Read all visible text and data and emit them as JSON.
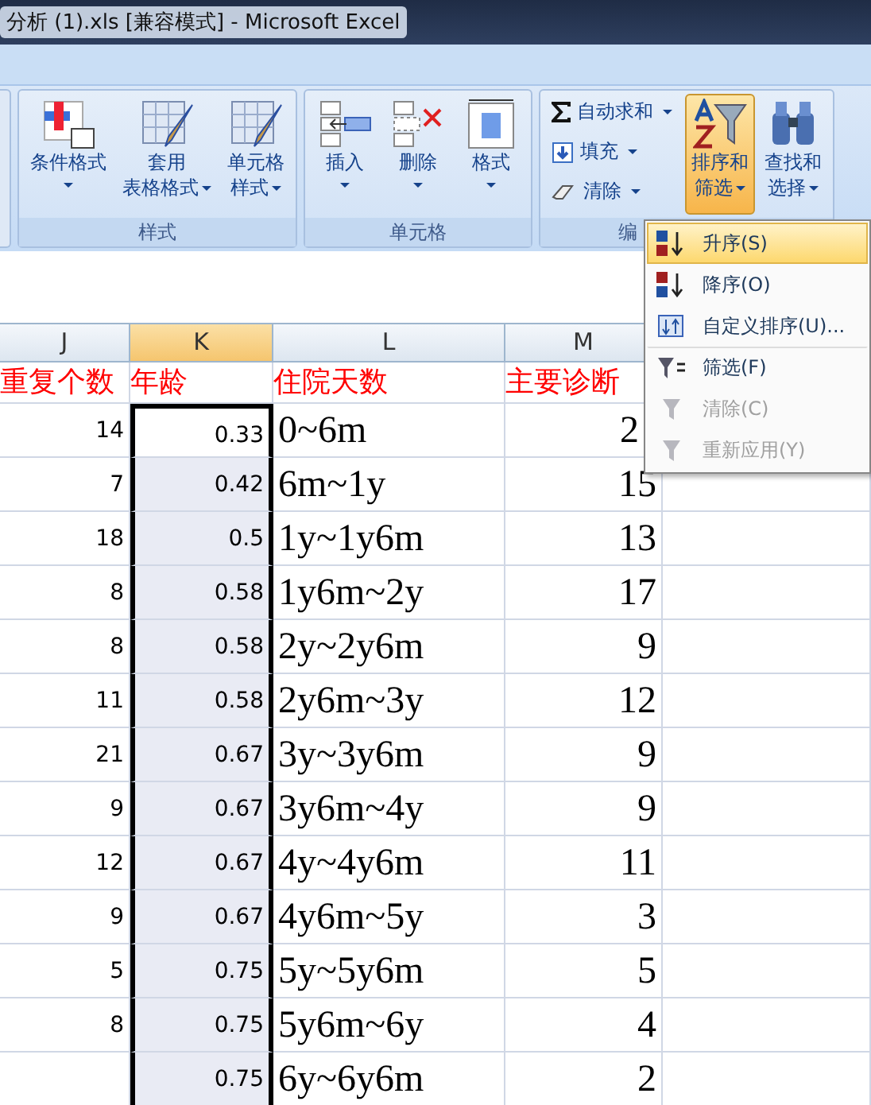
{
  "window": {
    "title": "分析 (1).xls  [兼容模式] - Microsoft Excel"
  },
  "ribbon": {
    "groups": [
      {
        "label": "样式",
        "items": [
          {
            "kind": "large",
            "lines": [
              "条件格式"
            ],
            "selected": false
          },
          {
            "kind": "large",
            "lines": [
              "套用",
              "表格格式"
            ],
            "selected": false
          },
          {
            "kind": "large",
            "lines": [
              "单元格",
              "样式"
            ],
            "selected": false
          }
        ]
      },
      {
        "label": "单元格",
        "items": [
          {
            "kind": "large",
            "lines": [
              "插入"
            ],
            "selected": false
          },
          {
            "kind": "large",
            "lines": [
              "删除"
            ],
            "selected": false
          },
          {
            "kind": "large",
            "lines": [
              "格式"
            ],
            "selected": false
          }
        ]
      },
      {
        "label": "编",
        "items": [
          {
            "kind": "small",
            "lines": [
              "自动求和"
            ],
            "selected": false
          },
          {
            "kind": "small",
            "lines": [
              "填充"
            ],
            "selected": false
          },
          {
            "kind": "small",
            "lines": [
              "清除"
            ],
            "selected": false
          },
          {
            "kind": "large",
            "lines": [
              "排序和",
              "筛选"
            ],
            "selected": true
          },
          {
            "kind": "large",
            "lines": [
              "查找和",
              "选择"
            ],
            "selected": false
          }
        ]
      }
    ]
  },
  "sheet": {
    "columns": [
      {
        "label": "J",
        "selected": false
      },
      {
        "label": "K",
        "selected": true
      },
      {
        "label": "L",
        "selected": false
      },
      {
        "label": "M",
        "selected": false
      }
    ],
    "header": [
      "重复个数",
      "年龄",
      "住院天数",
      "主要诊断"
    ],
    "rows": [
      [
        "14",
        "0.33",
        "0~6m",
        "2"
      ],
      [
        "7",
        "0.42",
        "6m~1y",
        "15"
      ],
      [
        "18",
        "0.5",
        "1y~1y6m",
        "13"
      ],
      [
        "8",
        "0.58",
        "1y6m~2y",
        "17"
      ],
      [
        "8",
        "0.58",
        "2y~2y6m",
        "9"
      ],
      [
        "11",
        "0.58",
        "2y6m~3y",
        "12"
      ],
      [
        "21",
        "0.67",
        "3y~3y6m",
        "9"
      ],
      [
        "9",
        "0.67",
        "3y6m~4y",
        "9"
      ],
      [
        "12",
        "0.67",
        "4y~4y6m",
        "11"
      ],
      [
        "9",
        "0.67",
        "4y6m~5y",
        "3"
      ],
      [
        "5",
        "0.75",
        "5y~5y6m",
        "5"
      ],
      [
        "8",
        "0.75",
        "5y6m~6y",
        "4"
      ],
      [
        "",
        "0.75",
        "6y~6y6m",
        "2"
      ]
    ]
  },
  "menu": {
    "items": [
      {
        "label": "升序(S)",
        "selected": true,
        "disabled": false
      },
      {
        "label": "降序(O)",
        "selected": false,
        "disabled": false
      },
      {
        "label": "自定义排序(U)...",
        "selected": false,
        "disabled": false
      },
      {
        "label": "筛选(F)",
        "selected": false,
        "disabled": false
      },
      {
        "label": "清除(C)",
        "selected": false,
        "disabled": true
      },
      {
        "label": "重新应用(Y)",
        "selected": false,
        "disabled": true
      }
    ]
  }
}
